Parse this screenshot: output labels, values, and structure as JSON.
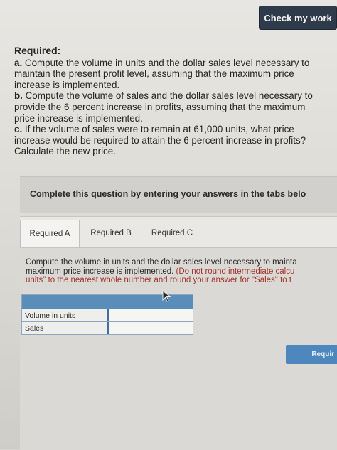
{
  "header": {
    "check_label": "Check my work"
  },
  "required": {
    "heading": "Required:",
    "items": [
      {
        "letter": "a.",
        "text": " Compute the volume in units and the dollar sales level necessary to"
      },
      {
        "letter": "",
        "text": "maintain the present profit level, assuming that the maximum price"
      },
      {
        "letter": "",
        "text": "increase is implemented."
      },
      {
        "letter": "b.",
        "text": " Compute the volume of sales and the dollar sales level necessary to"
      },
      {
        "letter": "",
        "text": "provide the 6 percent increase in profits, assuming that the maximum"
      },
      {
        "letter": "",
        "text": "price increase is implemented."
      },
      {
        "letter": "c.",
        "text": " If the volume of sales were to remain at 61,000 units, what price"
      },
      {
        "letter": "",
        "text": "increase would be required to attain the 6 percent increase in profits?"
      },
      {
        "letter": "",
        "text": "Calculate the new price."
      }
    ]
  },
  "instructions": {
    "text": "Complete this question by entering your answers in the tabs belo"
  },
  "tabs": [
    {
      "label": "Required A",
      "active": true
    },
    {
      "label": "Required B",
      "active": false
    },
    {
      "label": "Required C",
      "active": false
    }
  ],
  "prompt": {
    "line1": "Compute the volume in units and the dollar sales level necessary to mainta",
    "line2_plain": "maximum price increase is implemented. ",
    "line2_red": "(Do not round intermediate calcu",
    "line3_red": "units\" to the nearest whole number and round your answer for \"Sales\" to t"
  },
  "table": {
    "rows": [
      {
        "label": "Volume in units",
        "value": ""
      },
      {
        "label": "Sales",
        "value": ""
      }
    ]
  },
  "footer": {
    "next_label": "Requir"
  },
  "colors": {
    "accent": "#5a8db9",
    "button_dark": "#2f3b4a",
    "note_red": "#a2352b"
  }
}
